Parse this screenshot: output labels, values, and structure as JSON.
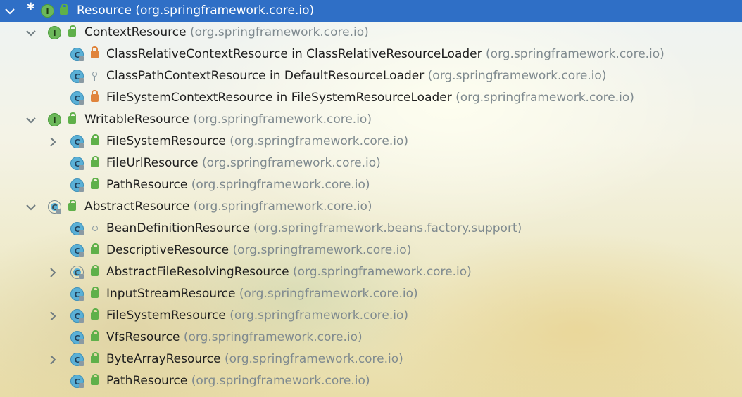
{
  "tree": [
    {
      "depth": 0,
      "expanded": true,
      "star": true,
      "kind": "interface",
      "visibility": "public",
      "name": "Resource",
      "pkg": "(org.springframework.core.io)",
      "selected": true
    },
    {
      "depth": 1,
      "expanded": true,
      "kind": "interface",
      "visibility": "public",
      "name": "ContextResource",
      "pkg": "(org.springframework.core.io)"
    },
    {
      "depth": 2,
      "kind": "class",
      "visibility": "private",
      "name": "ClassRelativeContextResource in ClassRelativeResourceLoader",
      "pkg": "(org.springframework.core.io)"
    },
    {
      "depth": 2,
      "kind": "class",
      "visibility": "protected",
      "name": "ClassPathContextResource in DefaultResourceLoader",
      "pkg": "(org.springframework.core.io)"
    },
    {
      "depth": 2,
      "kind": "class",
      "visibility": "private",
      "name": "FileSystemContextResource in FileSystemResourceLoader",
      "pkg": "(org.springframework.core.io)"
    },
    {
      "depth": 1,
      "expanded": true,
      "kind": "interface",
      "visibility": "public",
      "name": "WritableResource",
      "pkg": "(org.springframework.core.io)"
    },
    {
      "depth": 2,
      "expanded": false,
      "kind": "class",
      "visibility": "public",
      "name": "FileSystemResource",
      "pkg": "(org.springframework.core.io)"
    },
    {
      "depth": 2,
      "kind": "class",
      "visibility": "public",
      "name": "FileUrlResource",
      "pkg": "(org.springframework.core.io)"
    },
    {
      "depth": 2,
      "kind": "class",
      "visibility": "public",
      "name": "PathResource",
      "pkg": "(org.springframework.core.io)"
    },
    {
      "depth": 1,
      "expanded": true,
      "kind": "abstract",
      "visibility": "public",
      "name": "AbstractResource",
      "pkg": "(org.springframework.core.io)"
    },
    {
      "depth": 2,
      "kind": "class",
      "visibility": "package",
      "name": "BeanDefinitionResource",
      "pkg": "(org.springframework.beans.factory.support)"
    },
    {
      "depth": 2,
      "kind": "class",
      "visibility": "public",
      "name": "DescriptiveResource",
      "pkg": "(org.springframework.core.io)"
    },
    {
      "depth": 2,
      "expanded": false,
      "kind": "abstract",
      "visibility": "public",
      "name": "AbstractFileResolvingResource",
      "pkg": "(org.springframework.core.io)"
    },
    {
      "depth": 2,
      "kind": "class",
      "visibility": "public",
      "name": "InputStreamResource",
      "pkg": "(org.springframework.core.io)"
    },
    {
      "depth": 2,
      "expanded": false,
      "kind": "class",
      "visibility": "public",
      "name": "FileSystemResource",
      "pkg": "(org.springframework.core.io)"
    },
    {
      "depth": 2,
      "kind": "class",
      "visibility": "public",
      "name": "VfsResource",
      "pkg": "(org.springframework.core.io)"
    },
    {
      "depth": 2,
      "expanded": false,
      "kind": "class",
      "visibility": "public",
      "name": "ByteArrayResource",
      "pkg": "(org.springframework.core.io)"
    },
    {
      "depth": 2,
      "kind": "class",
      "visibility": "public",
      "name": "PathResource",
      "pkg": "(org.springframework.core.io)"
    }
  ],
  "icons": {
    "interface": "I",
    "class": "C",
    "abstract": "C"
  },
  "colors": {
    "selection": "#2f6fc6",
    "class_icon": "#5ab0d6",
    "interface_icon": "#6cb85a",
    "public": "#5fb04a",
    "private": "#e0843c"
  }
}
